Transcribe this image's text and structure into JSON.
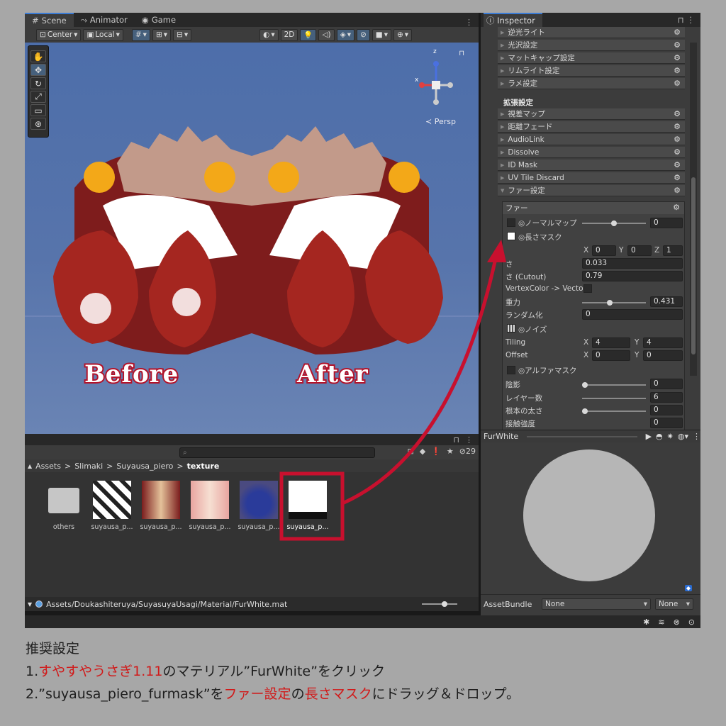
{
  "scene": {
    "tabs": [
      "Scene",
      "Animator",
      "Game"
    ],
    "tab_icons": [
      "grid-icon",
      "animator-icon",
      "gamepad-icon"
    ],
    "toolbar": {
      "pivot": "Center",
      "space": "Local",
      "mode_2d": "2D"
    },
    "persp_label": "Persp",
    "gizmo_axes": {
      "x": "x",
      "z": "z"
    },
    "before_label": "Before",
    "after_label": "After"
  },
  "project": {
    "search_placeholder": "",
    "hidden_count": "29",
    "breadcrumb": [
      "Assets",
      "Slimaki",
      "Suyausa_piero",
      "texture"
    ],
    "assets": [
      {
        "label": "others",
        "kind": "folder"
      },
      {
        "label": "suyausa_p...",
        "kind": "texture-bw"
      },
      {
        "label": "suyausa_p...",
        "kind": "texture-red"
      },
      {
        "label": "suyausa_p...",
        "kind": "texture-pink"
      },
      {
        "label": "suyausa_p...",
        "kind": "texture-blue"
      },
      {
        "label": "suyausa_p...",
        "kind": "texture-mask"
      }
    ],
    "footer_path": "Assets/Doukashiteruya/SuyasuyaUsagi/Material/FurWhite.mat"
  },
  "inspector": {
    "title": "Inspector",
    "sections_top": [
      "逆光ライト",
      "光沢設定",
      "マットキャップ設定",
      "リムライト設定",
      "ラメ設定"
    ],
    "ext_header": "拡張設定",
    "sections_ext": [
      "視差マップ",
      "距離フェード",
      "AudioLink",
      "Dissolve",
      "ID Mask",
      "UV Tile Discard",
      "ファー設定"
    ],
    "fur": {
      "title": "ファー",
      "normal_map_label": "◎ノーマルマップ",
      "normal_map_value": "0",
      "normal_map_level": 0.5,
      "length_mask_label": "◎長さマスク",
      "xyz": {
        "x_label": "X",
        "x": "0",
        "y_label": "Y",
        "y": "0",
        "z_label": "Z",
        "z": "1"
      },
      "length_label": "さ",
      "length_value": "0.033",
      "cutout_label": "さ (Cutout)",
      "cutout_value": "0.79",
      "vertex_color_label": "VertexColor -> Vecto",
      "gravity_label": "重力",
      "gravity_value": "0.431",
      "gravity_level": 0.431,
      "random_label": "ランダム化",
      "random_value": "0",
      "noise_label": "◎ノイズ",
      "tiling_label": "Tiling",
      "tiling_x": "4",
      "tiling_y": "4",
      "offset_label": "Offset",
      "offset_x": "0",
      "offset_y": "0",
      "alpha_label": "◎アルファマスク",
      "shadow_label": "陰影",
      "shadow_value": "0",
      "layers_label": "レイヤー数",
      "layers_value": "6",
      "root_width_label": "根本の太さ",
      "root_width_value": "0",
      "last_label": "接触強度",
      "last_value": "0"
    }
  },
  "preview": {
    "title": "FurWhite",
    "assetbundle_label": "AssetBundle",
    "assetbundle_value": "None",
    "variant_value": "None"
  },
  "caption": {
    "heading": "推奨設定",
    "line1": {
      "pre": "1.",
      "red": "すやすやうさぎ1.11",
      "post": "のマテリアル”FurWhite”をクリック"
    },
    "line2": {
      "pre": "2.”suyausa_piero_furmask”を",
      "red1": "ファー設定",
      "mid": "の",
      "red2": "長さマスク",
      "post": "にドラッグ＆ドロップ。"
    }
  },
  "colors": {
    "accent": "#3a7bd5",
    "annotation_red": "#c8102e",
    "caption_red": "#d11a1a"
  }
}
